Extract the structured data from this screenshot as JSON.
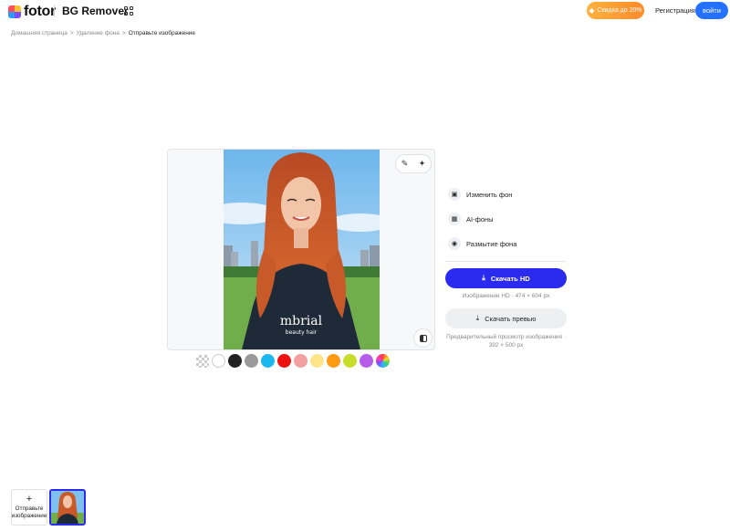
{
  "header": {
    "logo_text": "fotor",
    "product_name": "BG Remover",
    "apps_icon": "grid-icon",
    "promo_label": "Скидка до 20%",
    "register_label": "Регистрация",
    "login_label": "войти",
    "accent_color": "#2470ff"
  },
  "breadcrumb": {
    "items": [
      "Домашняя страница",
      "Удаление фона"
    ],
    "current": "Отправьте изображение",
    "separator": ">"
  },
  "editor": {
    "photo_text": "mbrial",
    "photo_text_2": "beauty hair",
    "tools": [
      "brush-icon",
      "magic-wand-icon"
    ],
    "compare_icon": "compare-icon"
  },
  "swatches": [
    {
      "name": "transparent",
      "color": "transparent"
    },
    {
      "name": "white",
      "color": "#ffffff"
    },
    {
      "name": "black",
      "color": "#222222"
    },
    {
      "name": "gray",
      "color": "#999999"
    },
    {
      "name": "cyan",
      "color": "#1bb8f0"
    },
    {
      "name": "red",
      "color": "#ee1111"
    },
    {
      "name": "pink",
      "color": "#f5a0a0"
    },
    {
      "name": "light-yellow",
      "color": "#ffe58a"
    },
    {
      "name": "orange",
      "color": "#ff9a12"
    },
    {
      "name": "lime",
      "color": "#c8dc2a"
    },
    {
      "name": "purple",
      "color": "#b55ce8"
    },
    {
      "name": "rainbow",
      "color": "rainbow"
    }
  ],
  "panel": {
    "options": [
      {
        "label": "Изменить фон",
        "icon": "image-icon"
      },
      {
        "label": "AI-фоны",
        "icon": "ai-image-icon"
      },
      {
        "label": "Размытие фона",
        "icon": "blur-icon"
      }
    ],
    "download_hd_label": "Скачать HD",
    "download_hd_info": "Изображение HD · 474 × 604 px",
    "download_preview_label": "Скачать превью",
    "download_preview_info": "Предварительный просмотр изображения · 392 × 500 px",
    "primary_color": "#2b2bf0"
  },
  "bottom": {
    "upload_label": "Отправьте изображение",
    "upload_icon": "plus-icon"
  }
}
